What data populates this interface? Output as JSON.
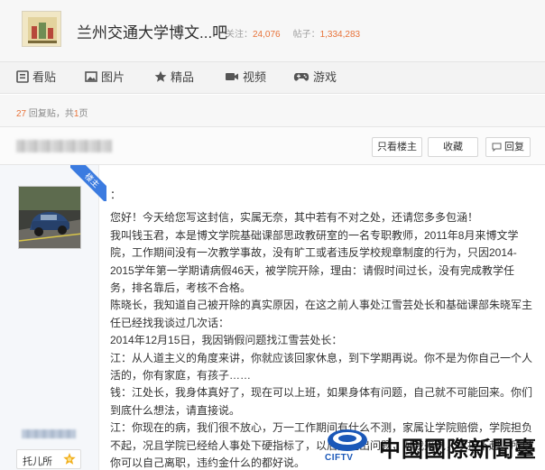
{
  "forum": {
    "title": "兰州交通大学博文...吧",
    "follow_label": "关注：",
    "follow_count": "24,076",
    "posts_label": "帖子：",
    "posts_count": "1,334,283"
  },
  "nav": {
    "tabs": [
      {
        "label": "看贴",
        "icon": "post-icon"
      },
      {
        "label": "图片",
        "icon": "image-icon"
      },
      {
        "label": "精品",
        "icon": "star-icon"
      },
      {
        "label": "视频",
        "icon": "video-icon"
      },
      {
        "label": "游戏",
        "icon": "gamepad-icon"
      }
    ]
  },
  "page_info": {
    "reply_count": "27",
    "reply_suffix": "回复贴，共",
    "page_count": "1",
    "page_suffix": "页"
  },
  "thread": {
    "only_host_label": "只看楼主",
    "favorite_label": "收藏",
    "reply_label": "回复"
  },
  "author": {
    "host_label": "楼主",
    "badge_label": "托儿所"
  },
  "post": {
    "paragraphs": [
      "：",
      "您好！今天给您写这封信，实属无奈，其中若有不对之处，还请您多多包涵！",
      "我叫钱玉君，本是博文学院基础课部思政教研室的一名专职教师，2011年8月来博文学院，工作期间没有一次教学事故，没有旷工或者违反学校规章制度的行为，只因2014-2015学年第一学期请病假46天，被学院开除，理由：请假时间过长，没有完成教学任务，排名靠后，考核不合格。",
      "陈晓长，我知道自己被开除的真实原因，在这之前人事处江雪芸处长和基础课部朱晓军主任已经找我谈过几次话：",
      "2014年12月15日，我因销假问题找江雪芸处长：",
      "江：从人道主义的角度来讲，你就应该回家休息，到下学期再说。你不是为你自己一个人活的，你有家庭，有孩子……",
      "钱：江处长，我身体真好了，现在可以上班，如果身体有问题，自己就不可能回来。你们到底什么想法，请直接说。",
      "江：你现在的病，我们很不放心，万一工作期间有什么不测，家属让学院赔偿，学院担负不起，况且学院已经给人事处下硬指标了，以后要是出问题，对我来说，承担不起。所以你可以自己离职，违约金什么的都好说。"
    ]
  },
  "watermark": {
    "brand_small": "CIFTV",
    "brand_big": "中國國際新聞臺"
  },
  "colors": {
    "accent_orange": "#e8733a",
    "ribbon_blue": "#3b7be0",
    "watermark_blue": "#1b58b8"
  }
}
